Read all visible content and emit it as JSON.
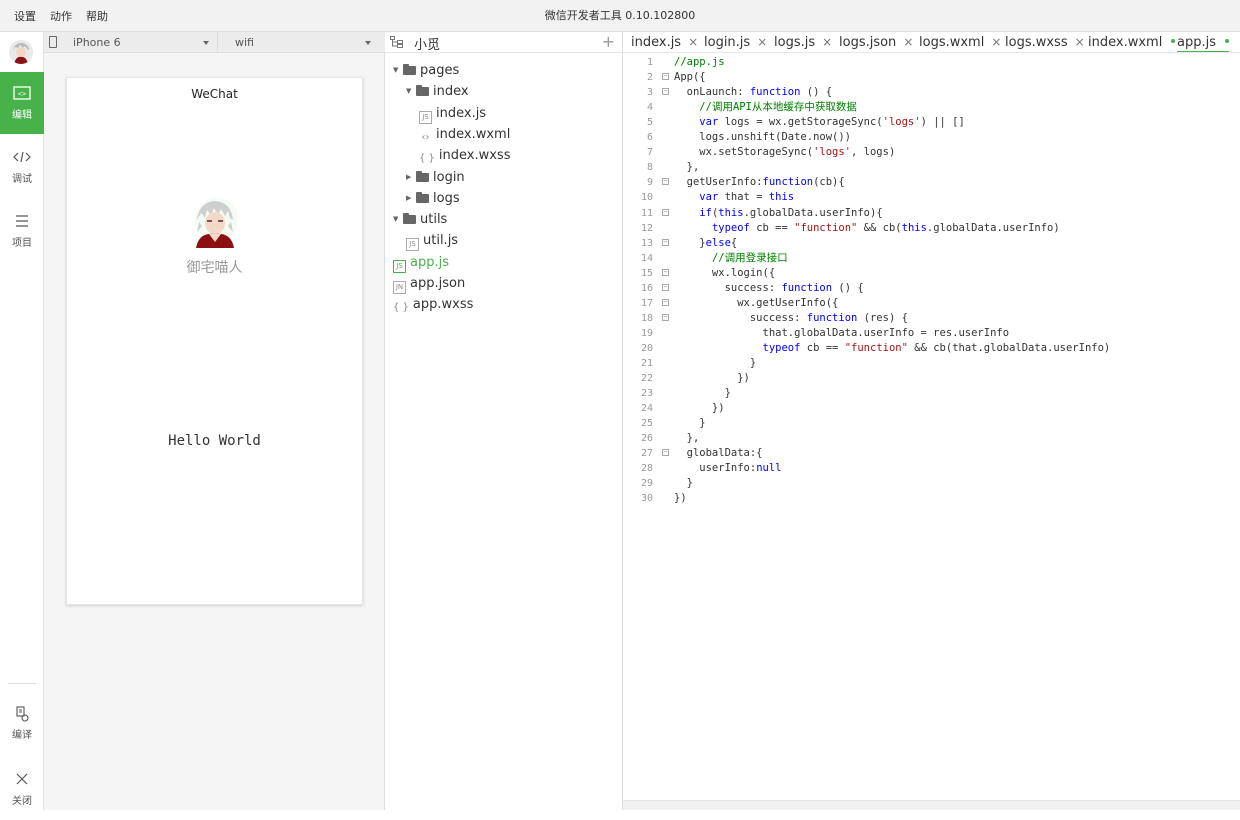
{
  "menu": [
    "设置",
    "动作",
    "帮助"
  ],
  "app_title": "微信开发者工具 0.10.102800",
  "nav": [
    {
      "label": "编辑",
      "icon": "edit-icon",
      "active": true
    },
    {
      "label": "调试",
      "icon": "debug-icon",
      "active": false
    },
    {
      "label": "项目",
      "icon": "project-icon",
      "active": false
    },
    {
      "label": "编译",
      "icon": "compile-icon",
      "active": false
    },
    {
      "label": "关闭",
      "icon": "close-icon",
      "active": false
    }
  ],
  "simulator": {
    "device": "iPhone 6",
    "network": "wifi",
    "phone_title": "WeChat",
    "user_name": "御宅喵人",
    "greeting": "Hello World"
  },
  "tree": {
    "project": "小觅",
    "items": [
      {
        "label": "pages",
        "type": "folder",
        "expanded": true,
        "depth": 0
      },
      {
        "label": "index",
        "type": "folder",
        "expanded": true,
        "depth": 1
      },
      {
        "label": "index.js",
        "type": "js",
        "depth": 2
      },
      {
        "label": "index.wxml",
        "type": "wxml",
        "depth": 2
      },
      {
        "label": "index.wxss",
        "type": "wxss",
        "depth": 2
      },
      {
        "label": "login",
        "type": "folder",
        "expanded": false,
        "depth": 1
      },
      {
        "label": "logs",
        "type": "folder",
        "expanded": false,
        "depth": 1
      },
      {
        "label": "utils",
        "type": "folder",
        "expanded": true,
        "depth": 0
      },
      {
        "label": "util.js",
        "type": "js",
        "depth": 1
      },
      {
        "label": "app.js",
        "type": "js",
        "depth": 0,
        "active": true
      },
      {
        "label": "app.json",
        "type": "json",
        "depth": 0
      },
      {
        "label": "app.wxss",
        "type": "wxss",
        "depth": 0
      }
    ]
  },
  "tabs": [
    {
      "label": "index.js",
      "mark": "×"
    },
    {
      "label": "login.js",
      "mark": "×"
    },
    {
      "label": "logs.js",
      "mark": "×"
    },
    {
      "label": "logs.json",
      "mark": "×"
    },
    {
      "label": "logs.wxml",
      "mark": "×"
    },
    {
      "label": "logs.wxss",
      "mark": "×"
    },
    {
      "label": "index.wxml",
      "mark": "dot"
    },
    {
      "label": "app.js",
      "mark": "dot",
      "active": true
    }
  ],
  "code": [
    "//app.js",
    "App({",
    "  onLaunch: function () {",
    "    //调用API从本地缓存中获取数据",
    "    var logs = wx.getStorageSync('logs') || []",
    "    logs.unshift(Date.now())",
    "    wx.setStorageSync('logs', logs)",
    "  },",
    "  getUserInfo:function(cb){",
    "    var that = this",
    "    if(this.globalData.userInfo){",
    "      typeof cb == \"function\" && cb(this.globalData.userInfo)",
    "    }else{",
    "      //调用登录接口",
    "      wx.login({",
    "        success: function () {",
    "          wx.getUserInfo({",
    "            success: function (res) {",
    "              that.globalData.userInfo = res.userInfo",
    "              typeof cb == \"function\" && cb(that.globalData.userInfo)",
    "            }",
    "          })",
    "        }",
    "      })",
    "    }",
    "  },",
    "  globalData:{",
    "    userInfo:null",
    "  }",
    "})"
  ],
  "fold_lines": [
    2,
    3,
    9,
    11,
    13,
    15,
    16,
    17,
    18,
    27
  ],
  "colors": {
    "accent": "#47b14a",
    "keyword": "#0000ff",
    "comment": "#008000",
    "string": "#a31515"
  }
}
